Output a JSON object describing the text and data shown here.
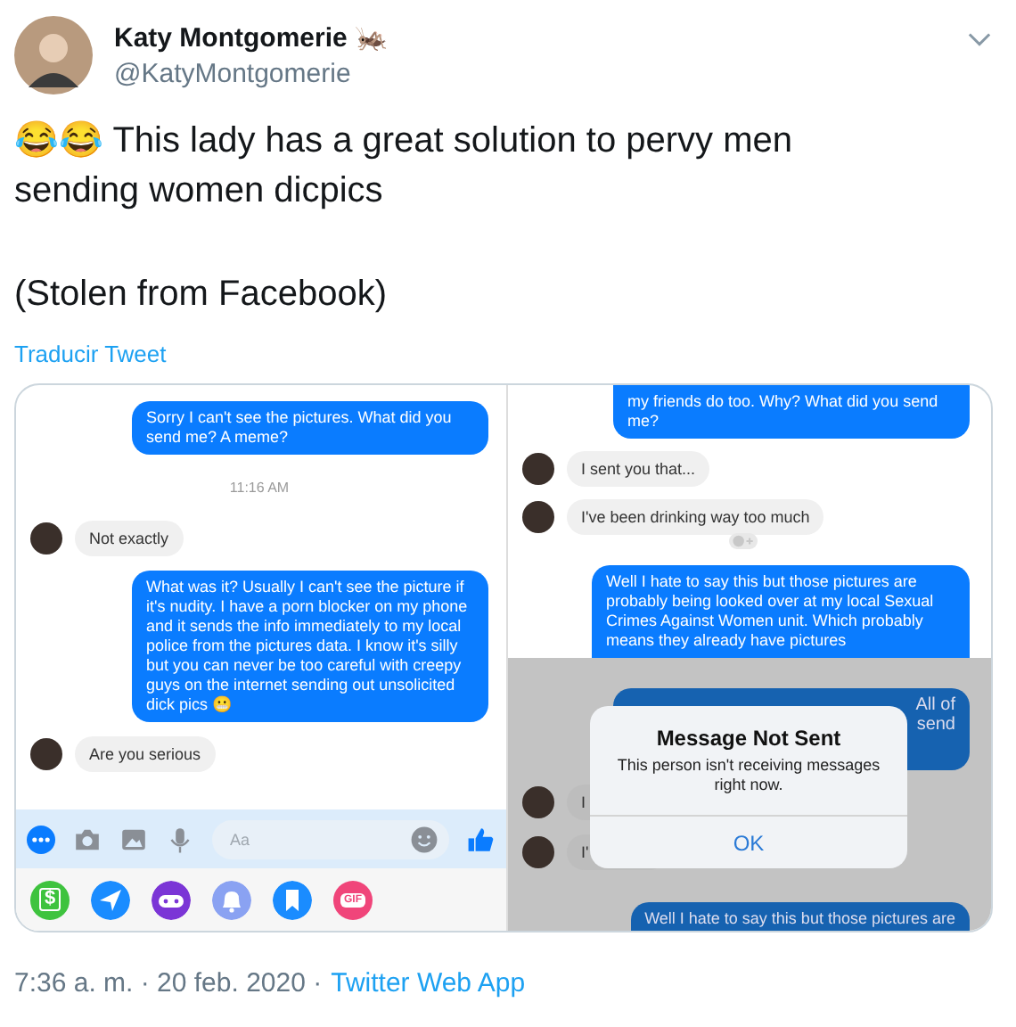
{
  "tweet": {
    "author": {
      "name": "Katy Montgomerie 🦗",
      "handle": "@KatyMontgomerie"
    },
    "paragraphs": [
      "😂😂 This lady has a great solution to pervy men sending women dicpics",
      "(Stolen from Facebook)"
    ],
    "translate_link": "Traducir Tweet",
    "media": {
      "left": {
        "messages": [
          {
            "kind": "outgoing",
            "text": "Sorry I can't see the pictures. What did you send me? A meme?"
          },
          {
            "kind": "time",
            "text": "11:16 AM"
          },
          {
            "kind": "incoming",
            "text": "Not exactly"
          },
          {
            "kind": "outgoing",
            "text": "What was it? Usually I can't see the picture if it's nudity. I have a porn blocker on my phone and it sends the info immediately to my local police from the pictures data. I know it's silly but you can never be too careful with creepy guys on the internet sending out unsolicited dick pics 😬"
          },
          {
            "kind": "incoming",
            "text": "Are you serious"
          }
        ],
        "composer": {
          "placeholder": "Aa"
        },
        "apps": [
          {
            "kind": "cash",
            "color": "#3ec33e",
            "label": "$"
          },
          {
            "kind": "send",
            "color": "#1a8cff"
          },
          {
            "kind": "game",
            "color": "#7b35d6"
          },
          {
            "kind": "bell",
            "color": "#8aa2f2"
          },
          {
            "kind": "bookmark",
            "color": "#1a8cff"
          },
          {
            "kind": "gif",
            "color": "#f0457a",
            "label": "GIF"
          }
        ]
      },
      "right": {
        "messages": [
          {
            "kind": "outgoing",
            "text": "my friends do too. Why? What did you send me?"
          },
          {
            "kind": "incoming",
            "text": "I sent you that..."
          },
          {
            "kind": "incoming",
            "text": "I've been drinking way too much",
            "reaction": true
          },
          {
            "kind": "outgoing",
            "text": "Well I hate to say this but those pictures are probably being looked over at my local Sexual Crimes Against Women unit. Which probably means they already have pictures"
          }
        ],
        "dimmed_messages": [
          {
            "kind": "outgoing",
            "lines": [
              "All of",
              "send"
            ]
          },
          {
            "kind": "incoming",
            "text": "I"
          },
          {
            "kind": "incoming",
            "text": "I'"
          },
          {
            "kind": "outgoing",
            "text": "Well I hate to say this but those pictures are"
          }
        ],
        "alert": {
          "title": "Message Not Sent",
          "message": "This person isn't receiving messages right now.",
          "button": "OK"
        }
      }
    },
    "footer": {
      "time_date": "7:36 a. m. · 20 feb. 2020 ·",
      "source": "Twitter Web App"
    }
  }
}
